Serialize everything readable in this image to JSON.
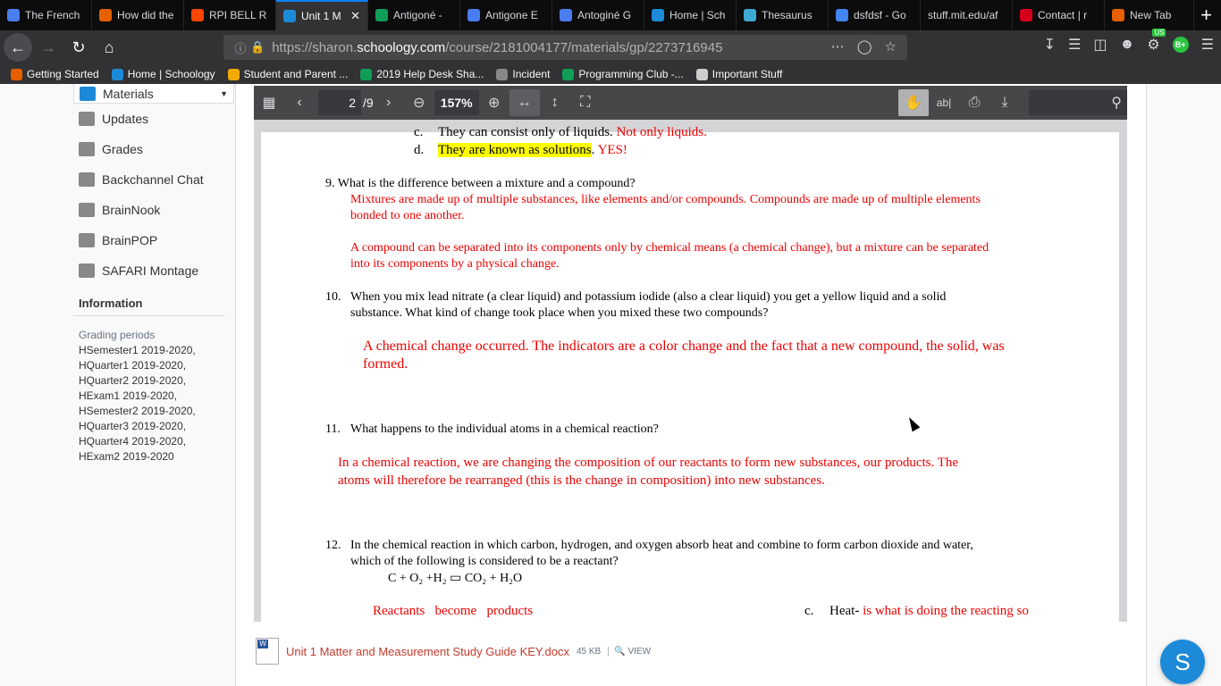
{
  "browser": {
    "tabs": [
      {
        "label": "The French",
        "icon": "docs-icon",
        "color": "#4a7ef0"
      },
      {
        "label": "How did the",
        "icon": "firefox-icon",
        "color": "#e66000"
      },
      {
        "label": "RPI BELL R",
        "icon": "reddit-icon",
        "color": "#ff4500"
      },
      {
        "label": "Unit 1 M",
        "icon": "schoology-icon",
        "color": "#1c8ad8",
        "active": true
      },
      {
        "label": "Antigoné -",
        "icon": "drive-icon",
        "color": "#0f9d58"
      },
      {
        "label": "Antigone E",
        "icon": "docs-icon",
        "color": "#4a7ef0"
      },
      {
        "label": "Antoginé G",
        "icon": "docs-icon",
        "color": "#4a7ef0"
      },
      {
        "label": "Home | Sch",
        "icon": "schoology-icon",
        "color": "#1c8ad8"
      },
      {
        "label": "Thesaurus",
        "icon": "thesaurus-icon",
        "color": "#3fa9d6"
      },
      {
        "label": "dsfdsf - Go",
        "icon": "google-icon",
        "color": "#4285f4"
      },
      {
        "label": "stuff.mit.edu/af",
        "icon": "",
        "color": ""
      },
      {
        "label": "Contact | r",
        "icon": "rpi-icon",
        "color": "#d6001c"
      },
      {
        "label": "New Tab",
        "icon": "firefox-icon",
        "color": "#e66000"
      }
    ],
    "url_prefix": "https://sharon.",
    "url_domain": "schoology.com",
    "url_path": "/course/2181004177/materials/gp/2273716945",
    "extension_badge": "US",
    "avatar_badge": "B+",
    "bookmarks": [
      {
        "label": "Getting Started",
        "icon": "firefox-icon",
        "color": "#e66000"
      },
      {
        "label": "Home | Schoology",
        "icon": "schoology-icon",
        "color": "#1c8ad8"
      },
      {
        "label": "Student and Parent ...",
        "icon": "powerschool-icon",
        "color": "#f2a900"
      },
      {
        "label": "2019 Help Desk Sha...",
        "icon": "drive-icon",
        "color": "#0f9d58"
      },
      {
        "label": "Incident",
        "icon": "globe-icon",
        "color": "#888888"
      },
      {
        "label": "Programming Club -...",
        "icon": "drive-icon",
        "color": "#0f9d58"
      },
      {
        "label": "Important Stuff",
        "icon": "folder-icon",
        "color": "#cccccc"
      }
    ]
  },
  "sidebar": {
    "materials_label": "Materials",
    "items": [
      {
        "label": "Updates",
        "icon": "updates-icon"
      },
      {
        "label": "Grades",
        "icon": "grades-icon"
      },
      {
        "label": "Backchannel Chat",
        "icon": "chat-icon"
      },
      {
        "label": "BrainNook",
        "icon": "brainnook-icon"
      },
      {
        "label": "BrainPOP",
        "icon": "brainpop-icon"
      },
      {
        "label": "SAFARI Montage",
        "icon": "safari-montage-icon"
      }
    ],
    "information_heading": "Information",
    "grading_periods_title": "Grading periods",
    "grading_periods": [
      "HSemester1 2019-2020,",
      "HQuarter1 2019-2020,",
      "HQuarter2 2019-2020,",
      "HExam1 2019-2020,",
      "HSemester2 2019-2020,",
      "HQuarter3 2019-2020,",
      "HQuarter4 2019-2020,",
      "HExam2 2019-2020"
    ]
  },
  "pdf": {
    "page_current": "2",
    "page_total": "/9",
    "zoom": "157%",
    "lines": {
      "c_letter": "c.",
      "c_text": "They can consist only of liquids.",
      "c_answer": "Not only liquids.",
      "d_letter": "d.",
      "d_text": "They are known as solutions",
      "d_period": ".",
      "d_answer": "YES!",
      "q9": "9. What is the difference between a mixture and a compound?",
      "q9_a1": "Mixtures are made up of multiple substances, like elements and/or compounds. Compounds are made up of multiple elements",
      "q9_a2": "bonded to one another.",
      "q9_a3": "A compound can be separated into its components only by chemical means (a chemical change), but a mixture can be separated",
      "q9_a4": "into its components by a physical change.",
      "q10_num": "10.",
      "q10_l1": "When you mix lead nitrate (a clear liquid) and potassium iodide (also a clear liquid) you get a yellow liquid and a solid",
      "q10_l2": "substance. What kind of change took place when you mixed these two compounds?",
      "q10_a1": "A chemical change occurred. The indicators are a color change and the fact that a new compound, the solid, was",
      "q10_a2": "formed.",
      "q11_num": "11.",
      "q11": "What happens to the individual atoms in a chemical reaction?",
      "q11_a1": "In a chemical reaction, we are changing the composition of our reactants to form new substances, our products. The",
      "q11_a2": "atoms will therefore be rearranged (this is the change in composition) into new substances.",
      "q12_num": "12.",
      "q12_l1": "In the chemical reaction in which carbon, hydrogen, and oxygen absorb heat and combine to form carbon dioxide and water,",
      "q12_l2": "which of the following is considered to be a reactant?",
      "q12_eq": "C + O₂ +H₂ ▭ CO₂ + H₂O",
      "q12_a1": "Reactants   become   products",
      "q12_c_letter": "c.",
      "q12_c_text": "Heat-",
      "q12_c_answer": "is what is doing the reacting so"
    }
  },
  "attachment": {
    "filename": "Unit 1 Matter and Measurement Study Guide KEY.docx",
    "size": "45 KB",
    "view": "VIEW"
  },
  "fab_label": "S"
}
